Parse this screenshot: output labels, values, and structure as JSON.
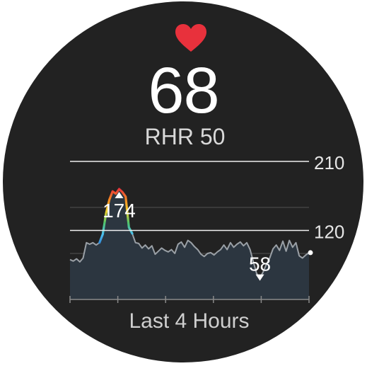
{
  "heart_rate": {
    "current_bpm": "68",
    "resting_label": "RHR 50"
  },
  "icons": {
    "heart": "heart-icon",
    "heart_color": "#e8313c"
  },
  "chart_data": {
    "type": "area",
    "title": "",
    "xlabel": "Last 4 Hours",
    "ylabel": "",
    "ylim": [
      30,
      210
    ],
    "y_ticks": [
      210,
      120
    ],
    "y_tick_labels": [
      "210",
      "120"
    ],
    "x_ticks_count": 6,
    "grid": true,
    "max_label": "174",
    "min_label": "58",
    "max_value": 174,
    "min_value": 58,
    "series": [
      {
        "values": [
          82,
          80,
          83,
          79,
          84,
          104,
          102,
          104,
          101,
          104,
          115,
          142,
          160,
          171,
          168,
          174,
          170,
          164,
          124,
          116,
          104,
          103,
          97,
          101,
          96,
          100,
          89,
          93,
          97,
          94,
          92,
          95,
          90,
          102,
          105,
          98,
          107,
          104,
          99,
          95,
          89,
          86,
          90,
          91,
          88,
          92,
          95,
          101,
          95,
          104,
          98,
          102,
          105,
          100,
          104,
          95,
          79,
          64,
          58,
          66,
          76,
          84,
          96,
          101,
          94,
          106,
          93,
          107,
          98,
          104,
          87,
          84,
          88,
          91
        ]
      }
    ],
    "colors": {
      "line": "#9aa0a6",
      "fill": "#2c3640",
      "gradient": [
        "#2b7bd0",
        "#4cc0f0",
        "#4fc36a",
        "#f2d22e",
        "#f58a22",
        "#e8313c"
      ],
      "grid": "#4a4a4a",
      "reference_lines": "#f0f0f0"
    }
  },
  "footer": {
    "range_label": "Last 4 Hours"
  }
}
